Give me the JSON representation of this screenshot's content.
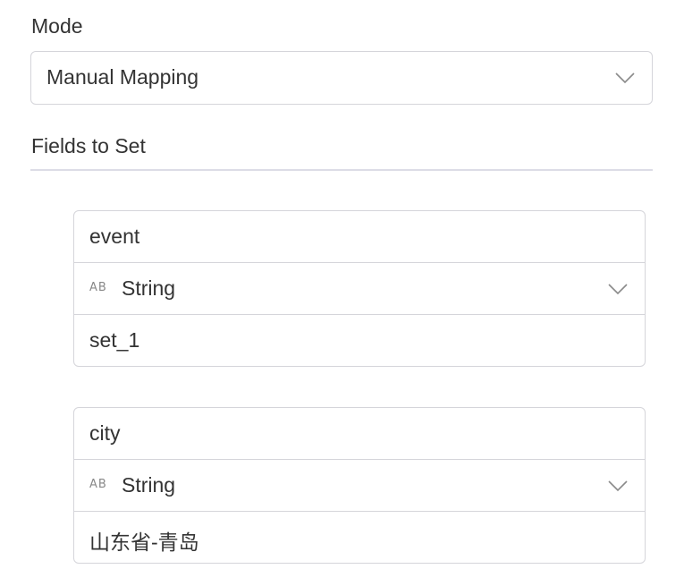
{
  "mode": {
    "label": "Mode",
    "selected": "Manual Mapping"
  },
  "section": {
    "title": "Fields to Set"
  },
  "fields": [
    {
      "name": "event",
      "type_icon": "AB",
      "type": "String",
      "value": "set_1"
    },
    {
      "name": "city",
      "type_icon": "AB",
      "type": "String",
      "value": "山东省-青岛"
    }
  ],
  "icons": {
    "dropdown": "chevron-down-icon",
    "type": "string-type-icon"
  },
  "colors": {
    "border": "#d5d5da",
    "divider": "#dcdce6",
    "text": "#333333",
    "muted": "#888888"
  }
}
